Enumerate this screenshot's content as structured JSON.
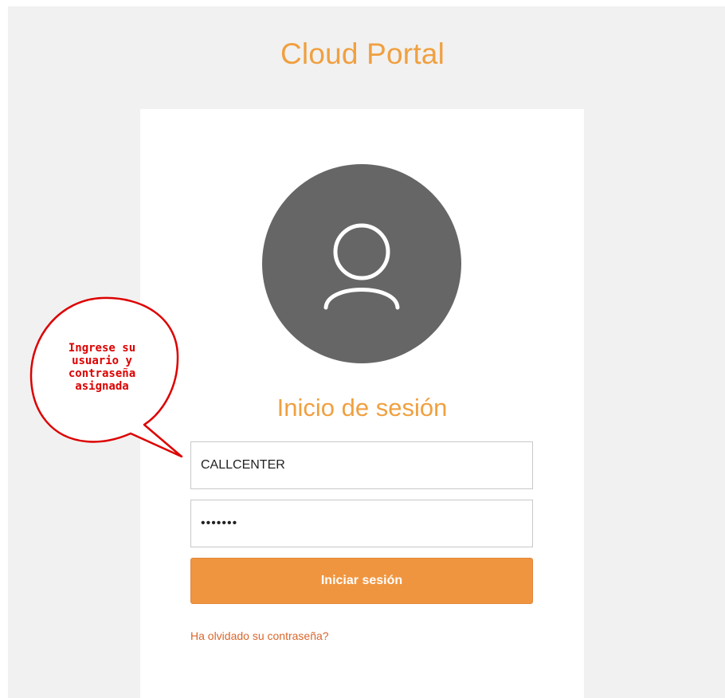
{
  "header": {
    "title": "Cloud Portal"
  },
  "login": {
    "avatar_icon": "user-icon",
    "heading": "Inicio de sesión",
    "username_value": "CALLCENTER",
    "password_value": "•••••••",
    "submit_label": "Iniciar sesión",
    "forgot_label": "Ha olvidado su contraseña?"
  },
  "annotation": {
    "lines": [
      "Ingrese su",
      "usuario y",
      "contraseña",
      "asignada"
    ]
  },
  "colors": {
    "accent": "#f0953f",
    "title": "#f0a040",
    "link": "#d9662b",
    "avatar_bg": "#666666",
    "annotation": "#dd0000"
  }
}
